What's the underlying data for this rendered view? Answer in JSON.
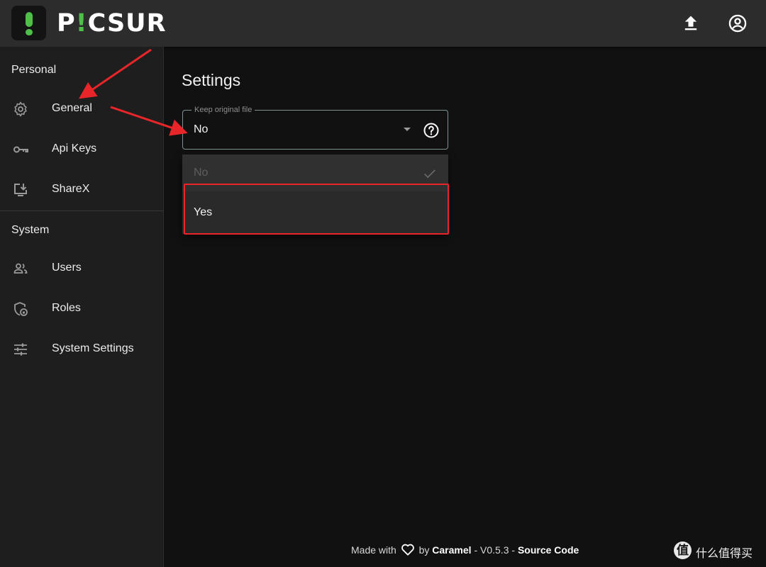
{
  "brand": {
    "name_prefix": "P",
    "name_accent": "!",
    "name_suffix": "CSUR",
    "accent_color": "#4ec04a"
  },
  "topbar": {
    "upload_icon": "upload-icon",
    "account_icon": "account-circle-icon"
  },
  "sidebar": {
    "personal_title": "Personal",
    "personal_items": [
      {
        "label": "General",
        "icon": "gear-icon"
      },
      {
        "label": "Api Keys",
        "icon": "key-icon"
      },
      {
        "label": "ShareX",
        "icon": "download-screen-icon"
      }
    ],
    "system_title": "System",
    "system_items": [
      {
        "label": "Users",
        "icon": "users-icon"
      },
      {
        "label": "Roles",
        "icon": "shield-lock-icon"
      },
      {
        "label": "System Settings",
        "icon": "sliders-icon"
      }
    ]
  },
  "main": {
    "title": "Settings",
    "field": {
      "label": "Keep original file",
      "value": "No",
      "options": [
        {
          "label": "No",
          "selected": true
        },
        {
          "label": "Yes",
          "selected": false
        }
      ]
    }
  },
  "footer": {
    "made_with": "Made with",
    "by": "by",
    "author": "Caramel",
    "separator": "-",
    "version": "V0.5.3",
    "source_link": "Source Code"
  },
  "watermark": {
    "symbol": "值",
    "text": "什么值得买"
  },
  "annotation_color": "#e8262a"
}
